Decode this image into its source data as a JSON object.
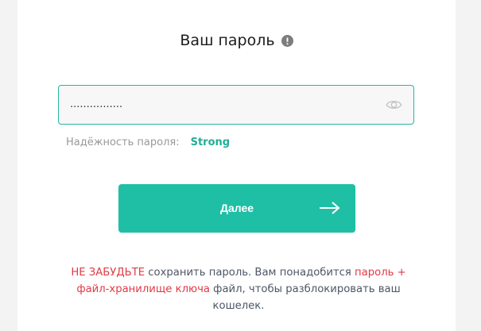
{
  "form": {
    "title": "Ваш пароль",
    "password_value": "................",
    "strength_label": "Надёжность пароля:",
    "strength_value": "Strong",
    "next_label": "Далее"
  },
  "notice": {
    "part1": "НЕ ЗАБУДЬТЕ",
    "part2": " сохранить пароль. Вам понадобится ",
    "part3": "пароль + файл-хранилище ключа",
    "part4": " файл, чтобы разблокировать ваш кошелек."
  },
  "icons": {
    "info": "info-icon",
    "eye": "eye-icon",
    "arrow": "arrow-right-icon"
  },
  "colors": {
    "accent": "#1fbfa6",
    "strength": "#22ad97",
    "warning": "#e03a45",
    "border": "#27b7a1"
  }
}
